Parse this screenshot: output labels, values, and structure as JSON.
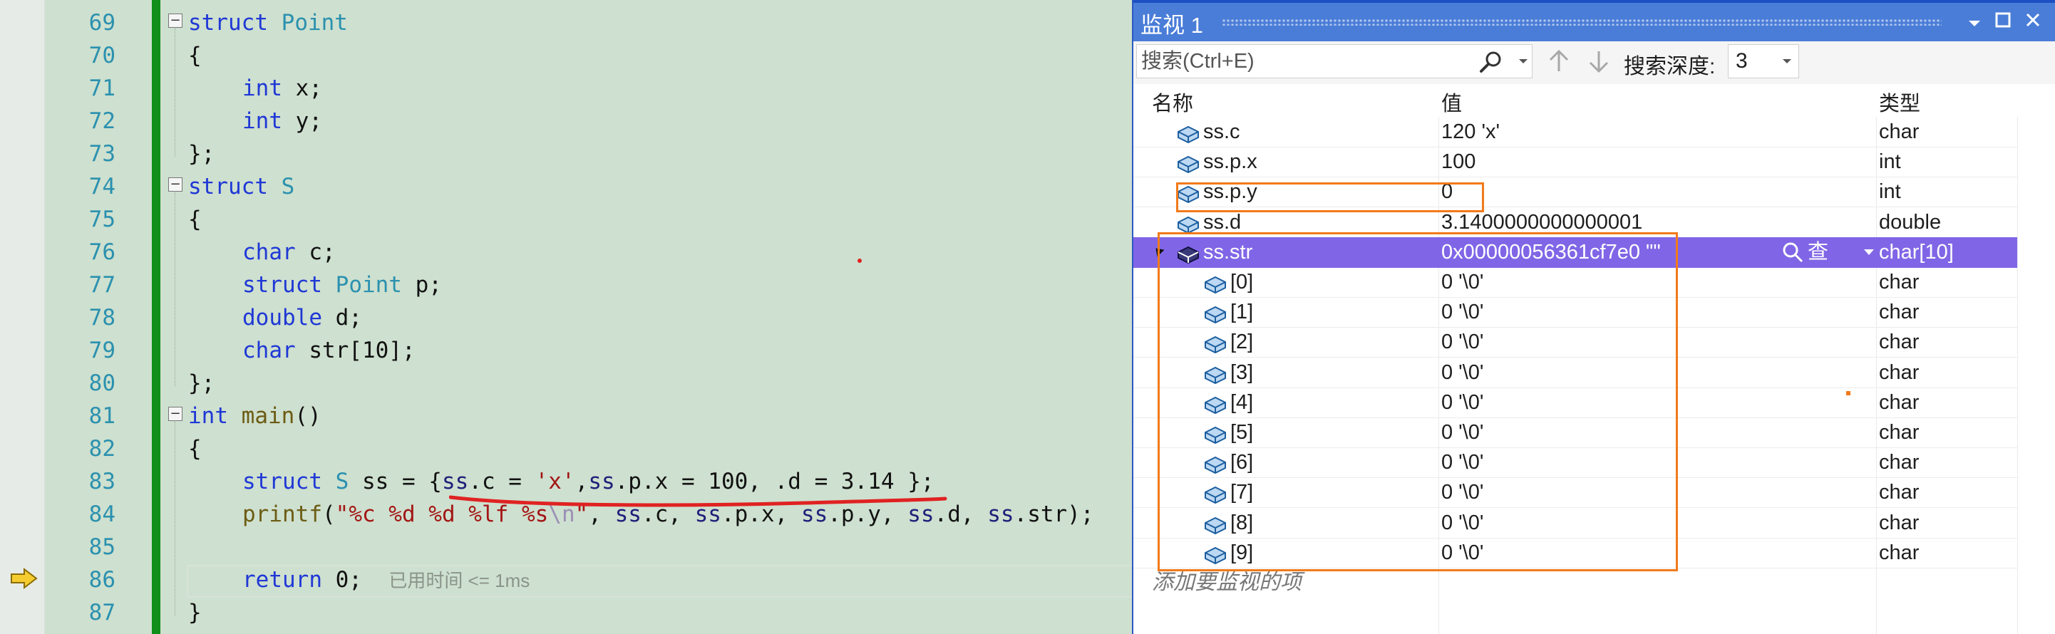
{
  "editor": {
    "line_numbers": [
      "69",
      "70",
      "71",
      "72",
      "73",
      "74",
      "75",
      "76",
      "77",
      "78",
      "79",
      "80",
      "81",
      "82",
      "83",
      "84",
      "85",
      "86",
      "87"
    ],
    "code": {
      "l69": {
        "kw": "struct",
        "ty": "Point"
      },
      "l70": "{",
      "l71": {
        "kw": "int",
        "rest": " x;"
      },
      "l72": {
        "kw": "int",
        "rest": " y;"
      },
      "l73": "};",
      "l74": {
        "kw": "struct",
        "ty": "S"
      },
      "l75": "{",
      "l76": {
        "kw": "char",
        "rest": " c;"
      },
      "l77": {
        "kw": "struct",
        "ty": "Point",
        "rest": " p;"
      },
      "l78": {
        "kw": "double",
        "rest": " d;"
      },
      "l79": {
        "kw": "char",
        "rest": " str[10];"
      },
      "l80": "};",
      "l81": {
        "kw": "int",
        "fn": "main",
        "rest": "()"
      },
      "l82": "{",
      "l83": {
        "kw": "struct",
        "ty": "S",
        "p1": " ss = {",
        "m1": "ss",
        "p2": ".c = ",
        "str": "'x'",
        "p3": ",",
        "m2": "ss",
        "p4": ".p.x = 100, .d = 3.14 };"
      },
      "l84": {
        "fn": "printf",
        "p1": "(",
        "s1": "\"%c %d %d %lf %s",
        "esc": "\\n",
        "s2": "\"",
        "p2": ", ",
        "a1": "ss",
        "p3": ".c, ",
        "a2": "ss",
        "p4": ".p.x, ",
        "a3": "ss",
        "p5": ".p.y, ",
        "a4": "ss",
        "p6": ".d, ",
        "a5": "ss",
        "p7": ".str);"
      },
      "l85": "",
      "l86": {
        "kw": "return",
        "rest": " 0;",
        "elapsed": "已用时间 <= 1ms"
      },
      "l87": "}"
    }
  },
  "watch": {
    "title": "监视 1",
    "search_placeholder": "搜索(Ctrl+E)",
    "depth_label": "搜索深度:",
    "depth_value": "3",
    "columns": {
      "name": "名称",
      "value": "值",
      "type": "类型"
    },
    "rows": [
      {
        "name": "ss.c",
        "value": "120 'x'",
        "type": "char"
      },
      {
        "name": "ss.p.x",
        "value": "100",
        "type": "int"
      },
      {
        "name": "ss.p.y",
        "value": "0",
        "type": "int"
      },
      {
        "name": "ss.d",
        "value": "3.1400000000000001",
        "type": "double"
      },
      {
        "name": "ss.str",
        "value": "0x00000056361cf7e0 \"\"",
        "type": "char[10]",
        "view_label": "查看"
      },
      {
        "name": "[0]",
        "value": "0 '\\0'",
        "type": "char"
      },
      {
        "name": "[1]",
        "value": "0 '\\0'",
        "type": "char"
      },
      {
        "name": "[2]",
        "value": "0 '\\0'",
        "type": "char"
      },
      {
        "name": "[3]",
        "value": "0 '\\0'",
        "type": "char"
      },
      {
        "name": "[4]",
        "value": "0 '\\0'",
        "type": "char"
      },
      {
        "name": "[5]",
        "value": "0 '\\0'",
        "type": "char"
      },
      {
        "name": "[6]",
        "value": "0 '\\0'",
        "type": "char"
      },
      {
        "name": "[7]",
        "value": "0 '\\0'",
        "type": "char"
      },
      {
        "name": "[8]",
        "value": "0 '\\0'",
        "type": "char"
      },
      {
        "name": "[9]",
        "value": "0 '\\0'",
        "type": "char"
      }
    ],
    "add_item_text": "添加要监视的项",
    "selection_color": "#8066e6",
    "annotation_color": "#f27a1a"
  }
}
